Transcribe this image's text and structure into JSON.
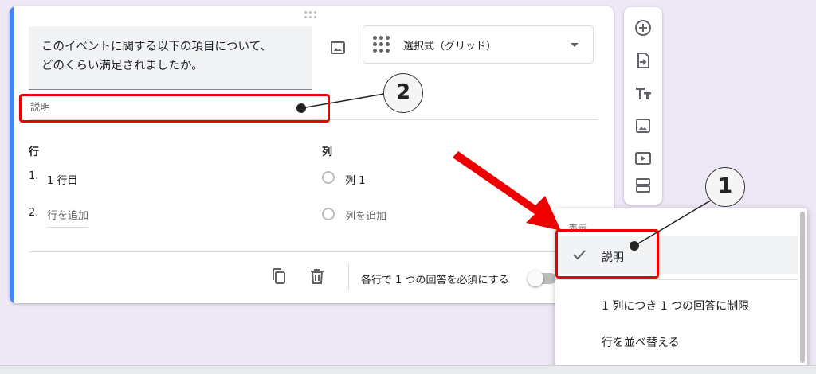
{
  "question": {
    "title_line1": "このイベントに関する以下の項目について、",
    "title_line2": "どのくらい満足されましたか。",
    "type_label": "選択式（グリッド）",
    "description_placeholder": "説明"
  },
  "grid": {
    "rows_heading": "行",
    "columns_heading": "列",
    "rows": [
      {
        "num": "1.",
        "label": "1 行目"
      },
      {
        "num": "2.",
        "label": "行を追加"
      }
    ],
    "columns": [
      {
        "label": "列 1"
      },
      {
        "label": "列を追加"
      }
    ]
  },
  "footer": {
    "require_label": "各行で 1 つの回答を必須にする"
  },
  "menu": {
    "header": "表示",
    "items": [
      "説明",
      "1 列につき 1 つの回答に制限",
      "行を並べ替える"
    ],
    "selected_index": 0
  },
  "callouts": {
    "one": "1",
    "two": "2"
  },
  "colors": {
    "accent": "#4285f4",
    "highlight": "#e00000",
    "background": "#ede7f6"
  },
  "icons": {
    "toolbar": [
      "add-question-icon",
      "import-icon",
      "title-icon",
      "image-icon",
      "video-icon",
      "section-icon"
    ]
  }
}
